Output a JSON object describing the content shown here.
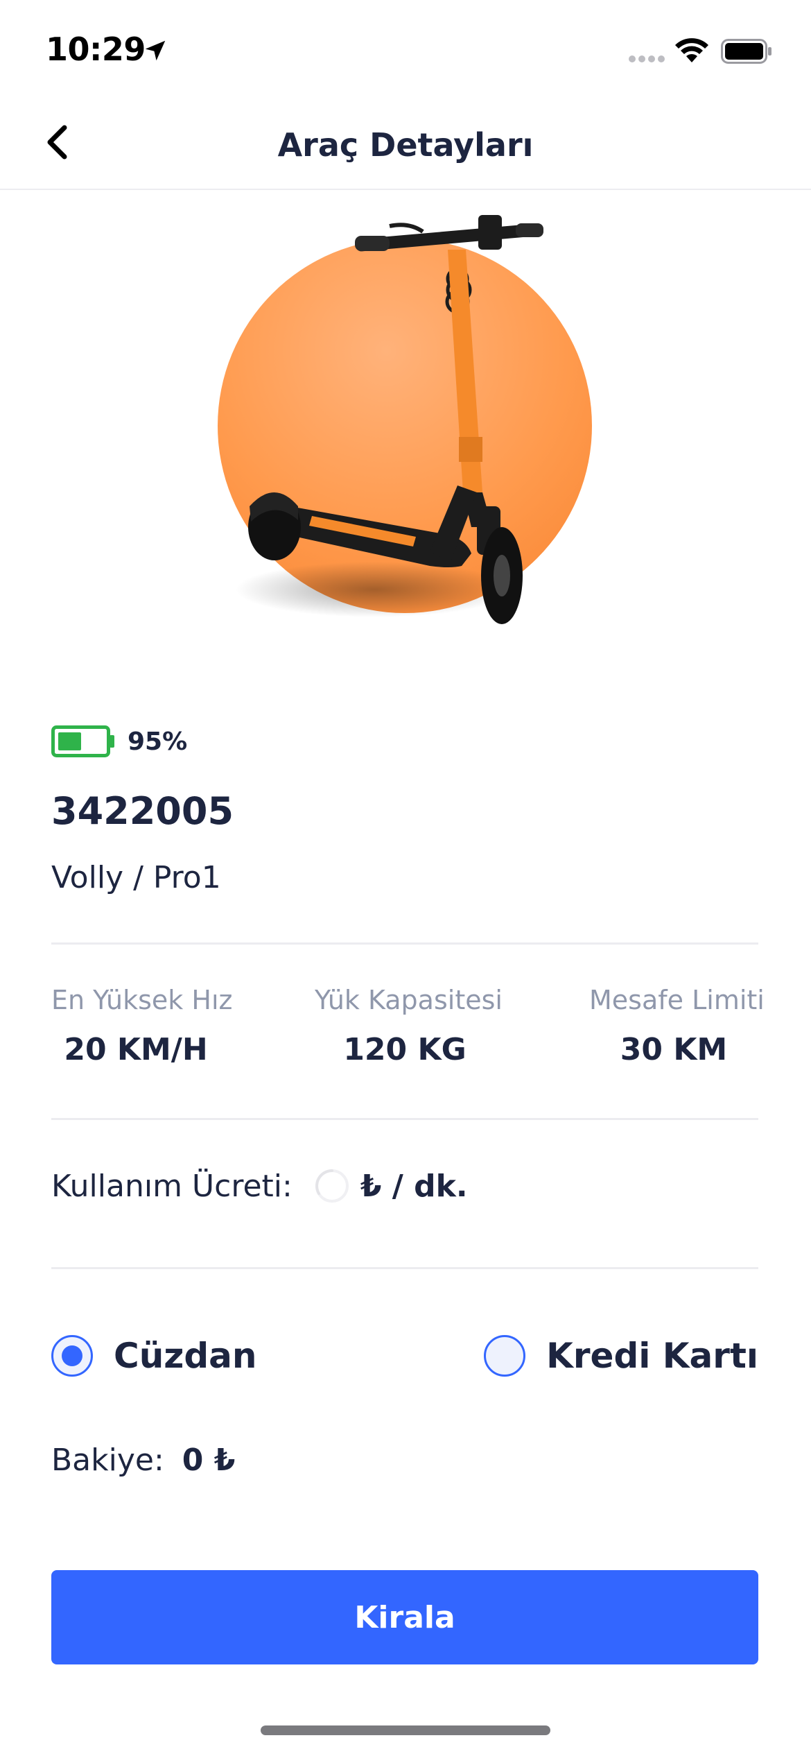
{
  "status_bar": {
    "time": "10:29",
    "icons": [
      "location-arrow-icon",
      "cellular-signal-icon",
      "wifi-icon",
      "battery-icon"
    ]
  },
  "nav": {
    "title": "Araç Detayları",
    "back_icon": "chevron-left-icon"
  },
  "vehicle": {
    "battery_percent_label": "95%",
    "battery_level": 0.95,
    "id": "3422005",
    "model": "Volly / Pro1"
  },
  "specs": [
    {
      "label": "En Yüksek Hız",
      "value": "20 KM/H"
    },
    {
      "label": "Yük Kapasitesi",
      "value": "120 KG"
    },
    {
      "label": "Mesafe Limiti",
      "value": "30 KM"
    }
  ],
  "fee": {
    "label": "Kullanım Ücreti:",
    "unit": "₺ / dk."
  },
  "payment": {
    "options": [
      {
        "label": "Cüzdan",
        "selected": true
      },
      {
        "label": "Kredi Kartı",
        "selected": false
      }
    ]
  },
  "balance": {
    "label": "Bakiye:",
    "value": "0 ₺"
  },
  "actions": {
    "rent_label": "Kirala"
  },
  "colors": {
    "accent": "#3366ff",
    "battery_green": "#2fb34a",
    "hero_orange": "#ff9a4d",
    "text_primary": "#1d2540",
    "text_secondary": "#8f97ab"
  }
}
